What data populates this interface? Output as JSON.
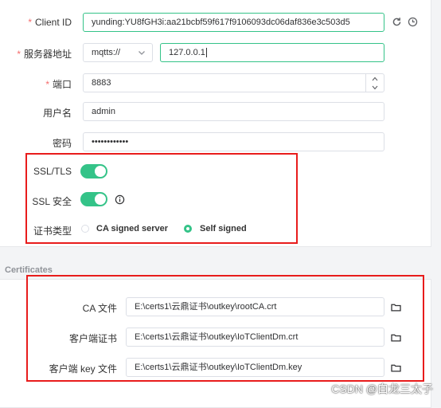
{
  "connection": {
    "client_id": {
      "label": "Client ID",
      "value": "yunding:YU8fGH3i:aa21bcbf59f617f9106093dc06daf836e3c503d5"
    },
    "server": {
      "label": "服务器地址",
      "protocol": "mqtts://",
      "host": "127.0.0.1"
    },
    "port": {
      "label": "端口",
      "value": "8883"
    },
    "username": {
      "label": "用户名",
      "value": "admin"
    },
    "password": {
      "label": "密码",
      "value": "••••••••••••"
    }
  },
  "ssl": {
    "tls_label": "SSL/TLS",
    "tls_enabled": true,
    "secure_label": "SSL 安全",
    "secure_enabled": true,
    "cert_type_label": "证书类型",
    "options": [
      "CA signed server",
      "Self signed"
    ],
    "selected": "Self signed"
  },
  "certificates": {
    "section_title": "Certificates",
    "ca_file": {
      "label": "CA 文件",
      "value": "E:\\certs1\\云鼎证书\\outkey\\rootCA.crt"
    },
    "client_cert": {
      "label": "客户端证书",
      "value": "E:\\certs1\\云鼎证书\\outkey\\IoTClientDm.crt"
    },
    "client_key": {
      "label": "客户端 key 文件",
      "value": "E:\\certs1\\云鼎证书\\outkey\\IoTClientDm.key"
    }
  },
  "watermark": "CSDN @白龙三太子",
  "colors": {
    "accent": "#34c388",
    "highlight_box": "#e81c1c",
    "required": "#f56c6c"
  }
}
